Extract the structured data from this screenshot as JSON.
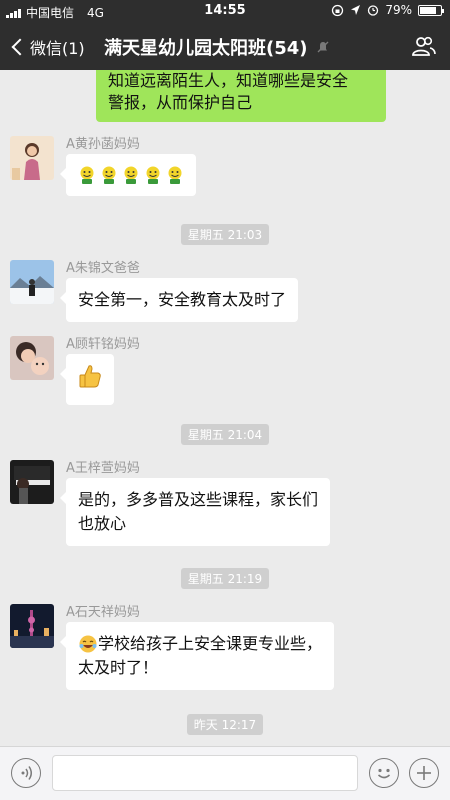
{
  "status_bar": {
    "carrier": "中国电信",
    "network": "4G",
    "time": "14:55",
    "battery_percent": "79%",
    "battery_level": 0.79
  },
  "nav": {
    "back_label": "微信(1)",
    "title": "满天星幼儿园太阳班(54)"
  },
  "messages": {
    "previous": {
      "line1": "知道远离陌生人，知道哪些是安全",
      "line2": "警报，从而保护自己"
    },
    "m1": {
      "sender": "A黄孙菡妈妈",
      "emoji": "smiley-row-icon",
      "emoji_count": 5
    },
    "t1": "星期五 21:03",
    "m2": {
      "sender": "A朱锦文爸爸",
      "text": "安全第一，安全教育太及时了"
    },
    "m3": {
      "sender": "A顾轩铭妈妈",
      "emoji": "thumbs-up-icon"
    },
    "t2": "星期五 21:04",
    "m4": {
      "sender": "A王梓萱妈妈",
      "line1": "是的，多多普及这些课程，家长们",
      "line2": "也放心"
    },
    "t3": "星期五 21:19",
    "m5": {
      "sender": "A石天祥妈妈",
      "line1": "学校给孩子上安全课更专业些，",
      "line2": "太及时了！",
      "emoji": "laughing-face-icon"
    },
    "t4": "昨天 12:17"
  },
  "input_bar": {
    "voice_icon": "voice-icon",
    "emoji_icon": "emoji-icon",
    "more_icon": "plus-icon"
  },
  "colors": {
    "bar_bg": "#2e2e2e",
    "chat_bg": "#ebebeb",
    "self_bubble": "#9fe55a",
    "other_bubble": "#ffffff"
  }
}
